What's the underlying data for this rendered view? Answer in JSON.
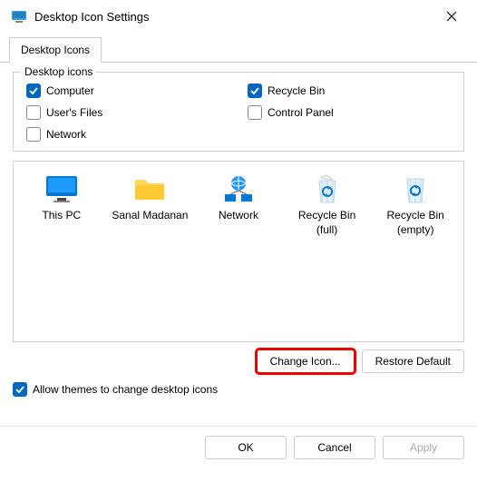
{
  "titlebar": {
    "title": "Desktop Icon Settings"
  },
  "tabs": {
    "main": "Desktop Icons"
  },
  "group": {
    "label": "Desktop icons",
    "items": {
      "computer": {
        "label": "Computer",
        "checked": true
      },
      "recyclebin": {
        "label": "Recycle Bin",
        "checked": true
      },
      "userfiles": {
        "label": "User's Files",
        "checked": false
      },
      "controlpanel": {
        "label": "Control Panel",
        "checked": false
      },
      "network": {
        "label": "Network",
        "checked": false
      }
    }
  },
  "preview": {
    "thispc": "This PC",
    "userfolder": "Sanal Madanan",
    "network": "Network",
    "binfull": "Recycle Bin (full)",
    "binempty": "Recycle Bin (empty)"
  },
  "buttons": {
    "changeicon": "Change Icon...",
    "restoredefault": "Restore Default",
    "ok": "OK",
    "cancel": "Cancel",
    "apply": "Apply"
  },
  "allow": {
    "label": "Allow themes to change desktop icons",
    "checked": true
  }
}
